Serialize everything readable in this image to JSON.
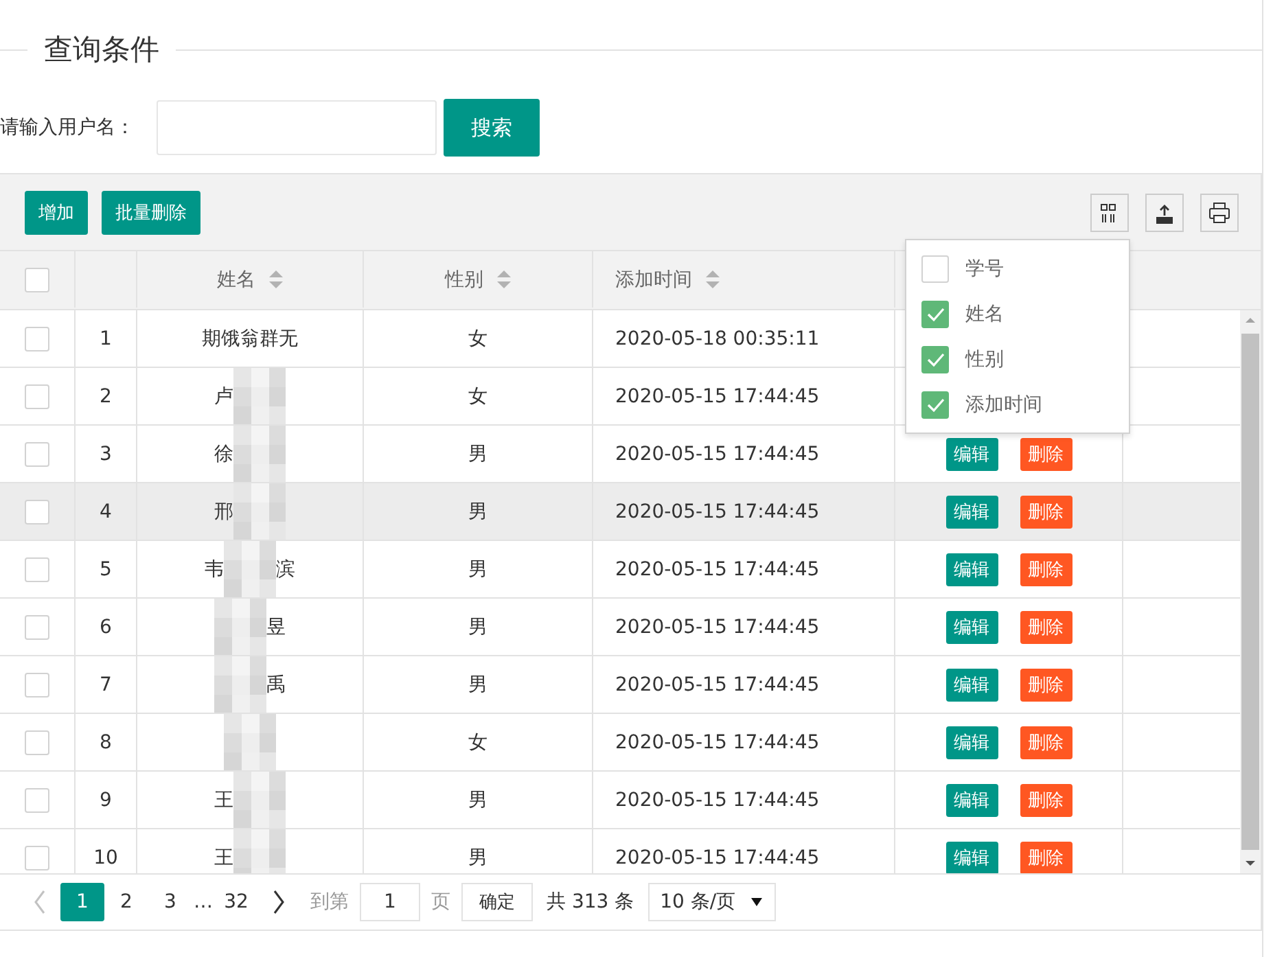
{
  "legend": "查询条件",
  "search": {
    "label": "请输入用户名：",
    "button": "搜索"
  },
  "toolbar": {
    "buttons": [
      "增加",
      "批量删除"
    ],
    "tools": [
      {
        "kind": "columns"
      },
      {
        "kind": "export"
      },
      {
        "kind": "print"
      }
    ]
  },
  "table": {
    "header_checked": false,
    "columns": [
      {
        "kind": "index"
      },
      {
        "kind": "text",
        "label": "姓名",
        "sortable": true
      },
      {
        "kind": "text",
        "label": "性别",
        "sortable": true
      },
      {
        "kind": "datetime",
        "label": "添加时间",
        "sortable": true
      },
      {
        "kind": "actions"
      }
    ],
    "rows": [
      {
        "checked": false,
        "highlighted": false,
        "index": "1",
        "masked": false,
        "name_left": "期饿翁群无",
        "gender": "女",
        "time": "2020-05-18 00:35:11"
      },
      {
        "checked": false,
        "highlighted": false,
        "index": "2",
        "masked": true,
        "name_left": "卢",
        "gender": "女",
        "time": "2020-05-15 17:44:45"
      },
      {
        "checked": false,
        "highlighted": false,
        "index": "3",
        "masked": true,
        "name_left": "徐",
        "gender": "男",
        "time": "2020-05-15 17:44:45",
        "actions": [
          "编辑",
          "删除"
        ]
      },
      {
        "checked": false,
        "highlighted": true,
        "index": "4",
        "masked": true,
        "name_left": "邢",
        "gender": "男",
        "time": "2020-05-15 17:44:45",
        "actions": [
          "编辑",
          "删除"
        ]
      },
      {
        "checked": false,
        "highlighted": false,
        "index": "5",
        "masked": true,
        "name_left": "韦",
        "name_right": "滨",
        "gender": "男",
        "time": "2020-05-15 17:44:45",
        "actions": [
          "编辑",
          "删除"
        ]
      },
      {
        "checked": false,
        "highlighted": false,
        "index": "6",
        "masked": true,
        "name_right": "昱",
        "gender": "男",
        "time": "2020-05-15 17:44:45",
        "actions": [
          "编辑",
          "删除"
        ]
      },
      {
        "checked": false,
        "highlighted": false,
        "index": "7",
        "masked": true,
        "name_right": "禹",
        "gender": "男",
        "time": "2020-05-15 17:44:45",
        "actions": [
          "编辑",
          "删除"
        ]
      },
      {
        "checked": false,
        "highlighted": false,
        "index": "8",
        "masked": true,
        "gender": "女",
        "time": "2020-05-15 17:44:45",
        "actions": [
          "编辑",
          "删除"
        ]
      },
      {
        "checked": false,
        "highlighted": false,
        "index": "9",
        "masked": true,
        "name_left": "王",
        "gender": "男",
        "time": "2020-05-15 17:44:45",
        "actions": [
          "编辑",
          "删除"
        ]
      },
      {
        "checked": false,
        "highlighted": false,
        "index": "10",
        "masked": true,
        "name_left": "王",
        "gender": "男",
        "time": "2020-05-15 17:44:45",
        "actions": [
          "编辑",
          "删除"
        ]
      }
    ]
  },
  "column_menu": [
    {
      "label": "学号",
      "checked": false
    },
    {
      "label": "姓名",
      "checked": true
    },
    {
      "label": "性别",
      "checked": true
    },
    {
      "label": "添加时间",
      "checked": true
    }
  ],
  "pagination": {
    "prev_disabled": true,
    "pages": [
      {
        "kind": "page",
        "label": "1",
        "selected": true
      },
      {
        "kind": "page",
        "label": "2",
        "selected": false
      },
      {
        "kind": "page",
        "label": "3",
        "selected": false
      },
      {
        "kind": "ellipsis",
        "label": "…",
        "selected": false
      },
      {
        "kind": "page",
        "label": "32",
        "selected": false
      }
    ],
    "goto_label": "到第",
    "goto_value": "1",
    "page_unit": "页",
    "confirm": "确定",
    "total": "共 313 条",
    "page_size": "10 条/页"
  }
}
